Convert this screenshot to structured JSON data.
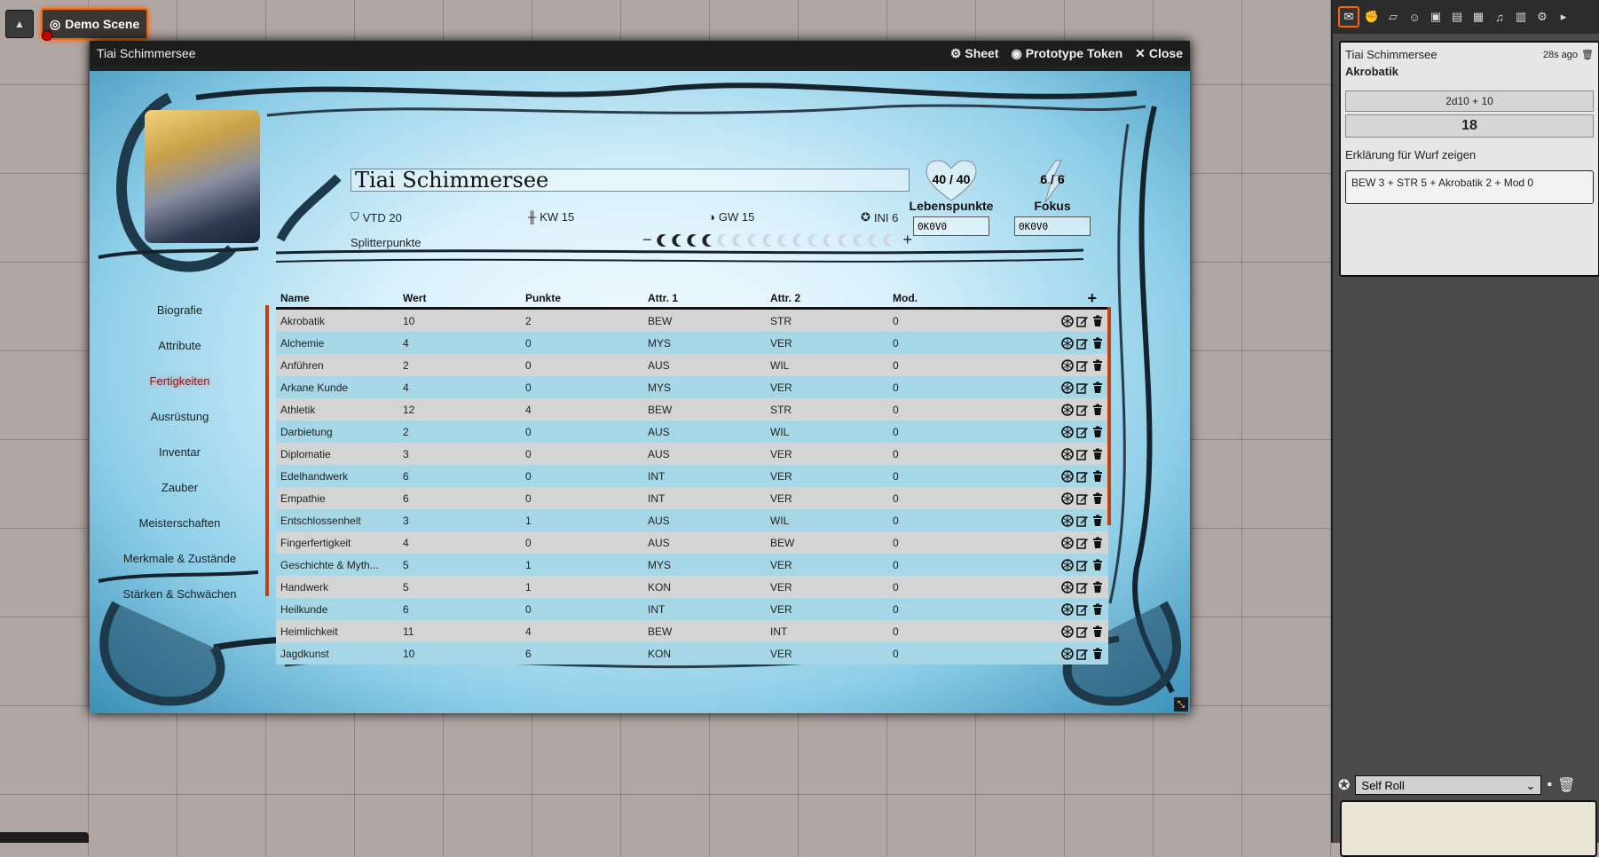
{
  "scene": {
    "label": "Demo Scene"
  },
  "window": {
    "title": "Tiai Schimmersee",
    "controls": {
      "sheet": "Sheet",
      "prototype": "Prototype Token",
      "close": "Close"
    }
  },
  "character": {
    "name": "Tiai Schimmersee",
    "stats": {
      "vtd": "VTD 20",
      "kw": "KW 15",
      "gw": "GW 15",
      "ini": "INI 6"
    },
    "splitter_label": "Splitterpunkte",
    "splitter": {
      "minus": "−",
      "plus": "+",
      "filled": 4,
      "total": 16
    },
    "health": {
      "value": "40 / 40",
      "label": "Lebenspunkte",
      "input": "0K0V0"
    },
    "focus": {
      "value": "6 / 6",
      "label": "Fokus",
      "input": "0K0V0"
    }
  },
  "nav": [
    "Biografie",
    "Attribute",
    "Fertigkeiten",
    "Ausrüstung",
    "Inventar",
    "Zauber",
    "Meisterschaften",
    "Merkmale & Zustände",
    "Stärken & Schwächen"
  ],
  "nav_active": "Fertigkeiten",
  "table": {
    "headers": {
      "name": "Name",
      "wert": "Wert",
      "punkte": "Punkte",
      "attr1": "Attr. 1",
      "attr2": "Attr. 2",
      "mod": "Mod.",
      "add": "+"
    },
    "rows": [
      {
        "name": "Akrobatik",
        "wert": "10",
        "punkte": "2",
        "a1": "BEW",
        "a2": "STR",
        "mod": "0"
      },
      {
        "name": "Alchemie",
        "wert": "4",
        "punkte": "0",
        "a1": "MYS",
        "a2": "VER",
        "mod": "0"
      },
      {
        "name": "Anführen",
        "wert": "2",
        "punkte": "0",
        "a1": "AUS",
        "a2": "WIL",
        "mod": "0"
      },
      {
        "name": "Arkane Kunde",
        "wert": "4",
        "punkte": "0",
        "a1": "MYS",
        "a2": "VER",
        "mod": "0"
      },
      {
        "name": "Athletik",
        "wert": "12",
        "punkte": "4",
        "a1": "BEW",
        "a2": "STR",
        "mod": "0"
      },
      {
        "name": "Darbietung",
        "wert": "2",
        "punkte": "0",
        "a1": "AUS",
        "a2": "WIL",
        "mod": "0"
      },
      {
        "name": "Diplomatie",
        "wert": "3",
        "punkte": "0",
        "a1": "AUS",
        "a2": "VER",
        "mod": "0"
      },
      {
        "name": "Edelhandwerk",
        "wert": "6",
        "punkte": "0",
        "a1": "INT",
        "a2": "VER",
        "mod": "0"
      },
      {
        "name": "Empathie",
        "wert": "6",
        "punkte": "0",
        "a1": "INT",
        "a2": "VER",
        "mod": "0"
      },
      {
        "name": "Entschlossenheit",
        "wert": "3",
        "punkte": "1",
        "a1": "AUS",
        "a2": "WIL",
        "mod": "0"
      },
      {
        "name": "Fingerfertigkeit",
        "wert": "4",
        "punkte": "0",
        "a1": "AUS",
        "a2": "BEW",
        "mod": "0"
      },
      {
        "name": "Geschichte & Myth...",
        "wert": "5",
        "punkte": "1",
        "a1": "MYS",
        "a2": "VER",
        "mod": "0"
      },
      {
        "name": "Handwerk",
        "wert": "5",
        "punkte": "1",
        "a1": "KON",
        "a2": "VER",
        "mod": "0"
      },
      {
        "name": "Heilkunde",
        "wert": "6",
        "punkte": "0",
        "a1": "INT",
        "a2": "VER",
        "mod": "0"
      },
      {
        "name": "Heimlichkeit",
        "wert": "11",
        "punkte": "4",
        "a1": "BEW",
        "a2": "INT",
        "mod": "0"
      },
      {
        "name": "Jagdkunst",
        "wert": "10",
        "punkte": "6",
        "a1": "KON",
        "a2": "VER",
        "mod": "0"
      }
    ]
  },
  "chat": {
    "speaker": "Tiai Schimmersee",
    "time": "28s ago",
    "flavor": "Akrobatik",
    "formula": "2d10 + 10",
    "total": "18",
    "explain_toggle": "Erklärung für Wurf zeigen",
    "explain": "BEW 3 + STR 5 + Akrobatik 2 + Mod 0"
  },
  "roll_mode": "Self Roll",
  "colors": {
    "accent": "#ff6400",
    "row_odd": "#d4d4d4",
    "row_even": "#a6d7e6",
    "active_nav": "#a01010"
  }
}
